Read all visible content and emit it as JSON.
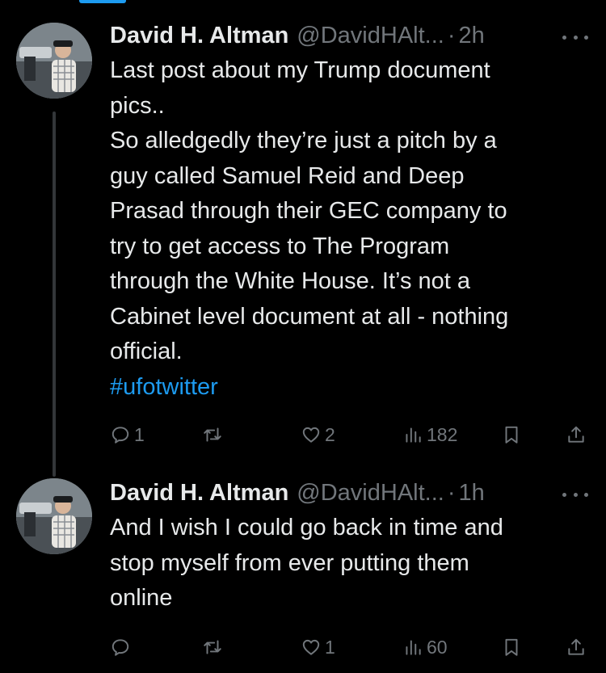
{
  "colors": {
    "background": "#000000",
    "text_primary": "#e7e9ea",
    "text_secondary": "#71767b",
    "accent": "#1d9bf0",
    "thread_line": "#333639"
  },
  "tweets": [
    {
      "author": {
        "display_name": "David H. Altman",
        "handle": "@DavidHAlt...",
        "avatar_icon": "profile-photo"
      },
      "separator": "·",
      "time": "2h",
      "body_lines": [
        "Last post about my Trump document",
        "pics..",
        "So alledgedly they’re just a pitch by a",
        "guy called Samuel Reid and Deep",
        "Prasad through their GEC company to",
        "try to get access to The Program",
        "through the White House. It’s not a",
        "Cabinet level document at all - nothing",
        "official."
      ],
      "hashtag": "#ufotwitter",
      "actions": {
        "replies": "1",
        "retweets": "",
        "likes": "2",
        "views": "182"
      }
    },
    {
      "author": {
        "display_name": "David H. Altman",
        "handle": "@DavidHAlt...",
        "avatar_icon": "profile-photo"
      },
      "separator": "·",
      "time": "1h",
      "body_lines": [
        "And I wish I could go back in time and",
        "stop myself from ever putting them",
        "online"
      ],
      "actions": {
        "replies": "",
        "retweets": "",
        "likes": "1",
        "views": "60"
      }
    }
  ]
}
